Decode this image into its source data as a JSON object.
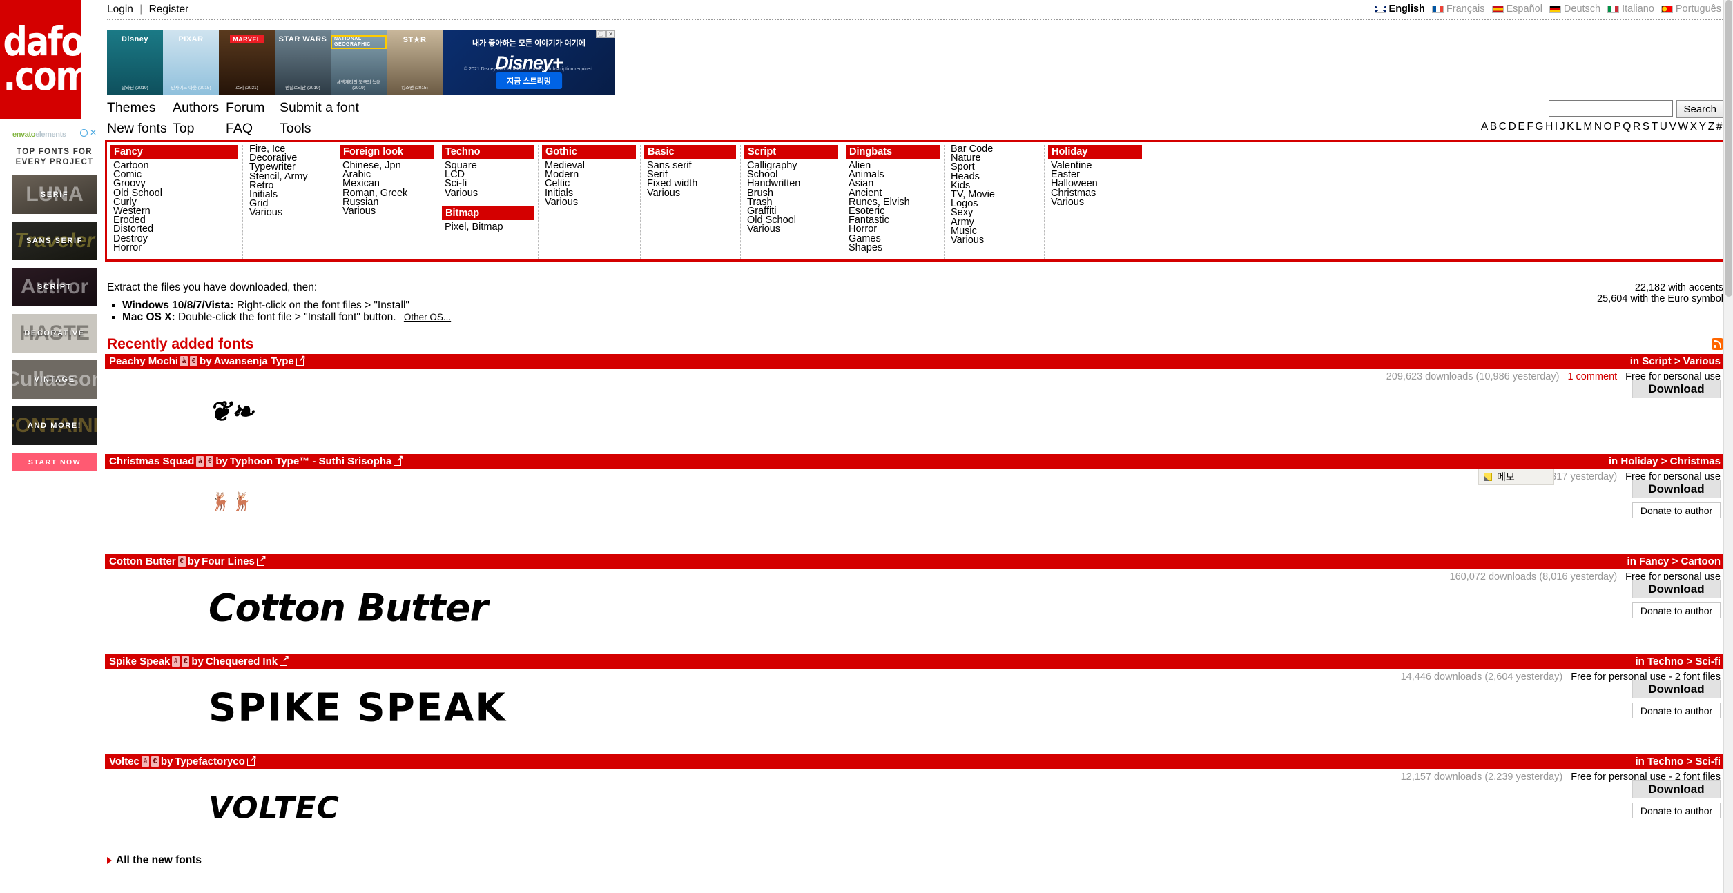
{
  "brand": {
    "name": "dafont",
    "tld": ".com"
  },
  "topbar": {
    "login": "Login",
    "separator": "|",
    "register": "Register",
    "languages": [
      {
        "label": "English",
        "flag": "flag-en",
        "active": true
      },
      {
        "label": "Français",
        "flag": "flag-fr",
        "active": false
      },
      {
        "label": "Español",
        "flag": "flag-es",
        "active": false
      },
      {
        "label": "Deutsch",
        "flag": "flag-de",
        "active": false
      },
      {
        "label": "Italiano",
        "flag": "flag-it",
        "active": false
      },
      {
        "label": "Português",
        "flag": "flag-pt",
        "active": false
      }
    ]
  },
  "banner_ad": {
    "brands": [
      "Disney",
      "PIXAR",
      "MARVEL",
      "STAR WARS",
      "NATIONAL GEOGRAPHIC",
      "ST★R"
    ],
    "captions": [
      "알라딘 (2019)",
      "인사이드 아웃 (2015)",
      "로키 (2021)",
      "만달로리안 (2019)",
      "세렝게티의 북극의 늑대 (2019)",
      "킹스맨 (2015)"
    ],
    "headline": "내가 좋아하는 모든 이야기가 여기에",
    "logo": "Disney+",
    "cta": "지금 스트리밍",
    "legal": "© 2021 Disney and its related entities. Subscription required.",
    "adchoices": [
      "ⓘ",
      "✕"
    ]
  },
  "nav": {
    "row1": [
      "Themes",
      "Authors",
      "Forum",
      "Submit a font"
    ],
    "row2": [
      "New fonts",
      "Top",
      "FAQ",
      "Tools"
    ]
  },
  "search": {
    "value": "",
    "placeholder": "",
    "button": "Search"
  },
  "alphabet": [
    "A",
    "B",
    "C",
    "D",
    "E",
    "F",
    "G",
    "H",
    "I",
    "J",
    "K",
    "L",
    "M",
    "N",
    "O",
    "P",
    "Q",
    "R",
    "S",
    "T",
    "U",
    "V",
    "W",
    "X",
    "Y",
    "Z",
    "#"
  ],
  "categories": [
    {
      "head": "Fancy",
      "items": [
        "Cartoon",
        "Comic",
        "Groovy",
        "Old School",
        "Curly",
        "Western",
        "Eroded",
        "Distorted",
        "Destroy",
        "Horror"
      ]
    },
    {
      "head": null,
      "items": [
        "Fire, Ice",
        "Decorative",
        "Typewriter",
        "Stencil, Army",
        "Retro",
        "Initials",
        "Grid",
        "Various"
      ]
    },
    {
      "head": "Foreign look",
      "items": [
        "Chinese, Jpn",
        "Arabic",
        "Mexican",
        "Roman, Greek",
        "Russian",
        "Various"
      ]
    },
    {
      "head": "Techno",
      "items": [
        "Square",
        "LCD",
        "Sci-fi",
        "Various"
      ],
      "head2": "Bitmap",
      "items2": [
        "Pixel, Bitmap"
      ]
    },
    {
      "head": "Gothic",
      "items": [
        "Medieval",
        "Modern",
        "Celtic",
        "Initials",
        "Various"
      ]
    },
    {
      "head": "Basic",
      "items": [
        "Sans serif",
        "Serif",
        "Fixed width",
        "Various"
      ]
    },
    {
      "head": "Script",
      "items": [
        "Calligraphy",
        "School",
        "Handwritten",
        "Brush",
        "Trash",
        "Graffiti",
        "Old School",
        "Various"
      ]
    },
    {
      "head": "Dingbats",
      "items": [
        "Alien",
        "Animals",
        "Asian",
        "Ancient",
        "Runes, Elvish",
        "Esoteric",
        "Fantastic",
        "Horror",
        "Games",
        "Shapes"
      ]
    },
    {
      "head": null,
      "items": [
        "Bar Code",
        "Nature",
        "Sport",
        "Heads",
        "Kids",
        "TV, Movie",
        "Logos",
        "Sexy",
        "Army",
        "Music",
        "Various"
      ]
    },
    {
      "head": "Holiday",
      "items": [
        "Valentine",
        "Easter",
        "Halloween",
        "Christmas",
        "Various"
      ]
    }
  ],
  "install": {
    "intro": "Extract the files you have downloaded, then:",
    "windows_label": "Windows 10/8/7/Vista:",
    "windows_text": "Right-click on the font files > \"Install\"",
    "mac_label": "Mac OS X:",
    "mac_text": "Double-click the font file > \"Install font\" button.",
    "other_os": "Other OS..."
  },
  "font_counts": {
    "accents": "22,182 with accents",
    "euro": "25,604 with the Euro symbol"
  },
  "recent": {
    "heading": "Recently added fonts",
    "all_new": "All the new fonts"
  },
  "fonts": [
    {
      "name": "Peachy Mochi",
      "badges": [
        "à",
        "€"
      ],
      "by": "by",
      "author": "Awansenja Type",
      "category": "in Script > Various",
      "downloads": "209,623 downloads (10,986 yesterday)",
      "comments": "1 comment",
      "license": "Free for personal use",
      "download_label": "Download",
      "donate_label": null,
      "sample": "Peachy Mochi"
    },
    {
      "name": "Christmas Squad",
      "badges": [
        "à",
        "€"
      ],
      "by": "by",
      "author": "Typhoon Type™ - Suthi Srisopha",
      "category": "in Holiday > Christmas",
      "downloads": "downloads (9,317 yesterday)",
      "comments": null,
      "license": "Free for personal use",
      "download_label": "Download",
      "donate_label": "Donate to author",
      "sample": "Christmas Squad"
    },
    {
      "name": "Cotton Butter",
      "badges": [
        "€"
      ],
      "by": "by",
      "author": "Four Lines",
      "category": "in Fancy > Cartoon",
      "downloads": "160,072 downloads (8,016 yesterday)",
      "comments": null,
      "license": "Free for personal use",
      "download_label": "Download",
      "donate_label": "Donate to author",
      "sample": "Cotton Butter"
    },
    {
      "name": "Spike Speak",
      "badges": [
        "à",
        "€"
      ],
      "by": "by",
      "author": "Chequered Ink",
      "category": "in Techno > Sci-fi",
      "downloads": "14,446 downloads (2,604 yesterday)",
      "comments": null,
      "license": "Free for personal use - 2 font files",
      "download_label": "Download",
      "donate_label": "Donate to author",
      "sample": "SPIKE SPEAK"
    },
    {
      "name": "Voltec",
      "badges": [
        "à",
        "€"
      ],
      "by": "by",
      "author": "Typefactoryco",
      "category": "in Techno > Sci-fi",
      "downloads": "12,157 downloads (2,239 yesterday)",
      "comments": null,
      "license": "Free for personal use - 2 font files",
      "download_label": "Download",
      "donate_label": "Donate to author",
      "sample": "VOLTEC"
    }
  ],
  "memo_tooltip": {
    "label": "메모"
  },
  "sidebar_ad": {
    "brand_dark": "envato",
    "brand_light": "elements",
    "headline": "TOP FONTS FOR EVERY PROJECT",
    "cards": [
      {
        "label": "SERIF",
        "word": "LUNA",
        "cls": "c-serif"
      },
      {
        "label": "SANS SERIF",
        "word": "Traveler",
        "cls": "c-sans"
      },
      {
        "label": "SCRIPT",
        "word": "Author",
        "cls": "c-script"
      },
      {
        "label": "DECORATIVE",
        "word": "HASTE",
        "cls": "c-deco"
      },
      {
        "label": "VINTAGE",
        "word": "Cullasson",
        "cls": "c-vint"
      },
      {
        "label": "AND MORE!",
        "word": "FONTAINE",
        "cls": "c-more"
      }
    ],
    "cta": "START NOW"
  },
  "colors": {
    "brand_red": "#d40000",
    "link_red": "#d40000",
    "muted": "#9a9a9a"
  }
}
